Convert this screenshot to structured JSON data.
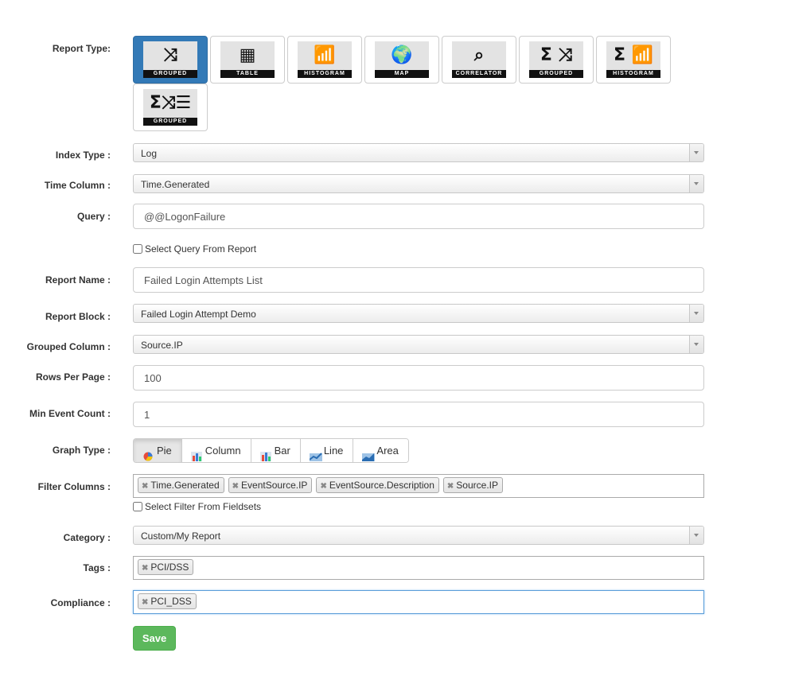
{
  "report_type": {
    "label": "Report Type:",
    "options": [
      {
        "caption": "GROUPED",
        "glyph": "⤨",
        "icon": "compress-arrows-icon",
        "active": true
      },
      {
        "caption": "TABLE",
        "glyph": "▦",
        "icon": "table-icon",
        "active": false
      },
      {
        "caption": "HISTOGRAM",
        "glyph": "📶",
        "icon": "histogram-icon",
        "active": false
      },
      {
        "caption": "MAP",
        "glyph": "🌍",
        "icon": "globe-pin-icon",
        "active": false
      },
      {
        "caption": "CORRELATOR",
        "glyph": "⌕",
        "icon": "correlator-icon",
        "active": false
      },
      {
        "caption": "GROUPED",
        "glyph": "Σ ⤨",
        "icon": "sum-grouped-icon",
        "active": false
      },
      {
        "caption": "HISTOGRAM",
        "glyph": "Σ 📶",
        "icon": "sum-histogram-icon",
        "active": false
      },
      {
        "caption": "GROUPED",
        "glyph": "Σ⤨☰",
        "icon": "sum-grouped-list-icon",
        "active": false
      }
    ]
  },
  "fields": {
    "index_type": {
      "label": "Index Type :",
      "value": "Log"
    },
    "time_column": {
      "label": "Time Column :",
      "value": "Time.Generated"
    },
    "query": {
      "label": "Query :",
      "value": "@@LogonFailure"
    },
    "select_query_checkbox": {
      "label": "Select Query From Report",
      "checked": false
    },
    "report_name": {
      "label": "Report Name :",
      "value": "Failed Login Attempts List"
    },
    "report_block": {
      "label": "Report Block :",
      "value": "Failed Login Attempt Demo"
    },
    "grouped_column": {
      "label": "Grouped Column :",
      "value": "Source.IP"
    },
    "rows_per_page": {
      "label": "Rows Per Page :",
      "value": "100"
    },
    "min_event_count": {
      "label": "Min Event Count :",
      "value": "1"
    },
    "graph_type": {
      "label": "Graph Type :",
      "options": [
        {
          "label": "Pie",
          "icon": "pie-chart-icon",
          "active": true
        },
        {
          "label": "Column",
          "icon": "column-chart-icon",
          "active": false
        },
        {
          "label": "Bar",
          "icon": "bar-chart-icon",
          "active": false
        },
        {
          "label": "Line",
          "icon": "line-chart-icon",
          "active": false
        },
        {
          "label": "Area",
          "icon": "area-chart-icon",
          "active": false
        }
      ]
    },
    "filter_columns": {
      "label": "Filter Columns :",
      "tags": [
        "Time.Generated",
        "EventSource.IP",
        "EventSource.Description",
        "Source.IP"
      ]
    },
    "select_filter_checkbox": {
      "label": "Select Filter From Fieldsets",
      "checked": false
    },
    "category": {
      "label": "Category :",
      "value": "Custom/My Report"
    },
    "tags": {
      "label": "Tags :",
      "tags": [
        "PCI/DSS"
      ]
    },
    "compliance": {
      "label": "Compliance :",
      "tags": [
        "PCI_DSS"
      ]
    }
  },
  "actions": {
    "save_label": "Save"
  },
  "colors": {
    "primary": "#337ab7",
    "success": "#5cb85c",
    "focus": "#5b9dd9"
  }
}
